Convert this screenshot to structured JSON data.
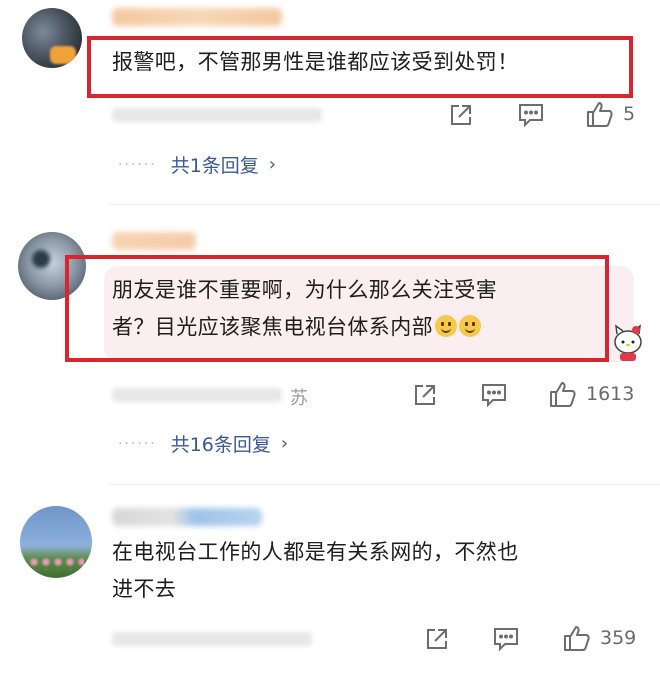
{
  "comments": [
    {
      "text": "报警吧，不管那男性是谁都应该受到处罚！",
      "likes": "5",
      "replies": "共1条回复"
    },
    {
      "text_line1": "朋友是谁不重要啊，为什么那么关注受害",
      "text_line2": "者？目光应该聚焦电视台体系内部",
      "location_fragment": "苏",
      "likes": "1613",
      "replies": "共16条回复"
    },
    {
      "text_line1": "在电视台工作的人都是有关系网的，不然也",
      "text_line2": "进不去",
      "likes": "359"
    }
  ],
  "icons": {
    "share": "share-icon",
    "comment": "comment-icon",
    "like": "thumbs-up-icon",
    "chevron": "chevron-right-icon"
  },
  "colors": {
    "highlight_box": "#d9252f",
    "reply_link": "#3b5897"
  },
  "glyphs": {
    "ellipsis": "······",
    "chevron": "›"
  }
}
